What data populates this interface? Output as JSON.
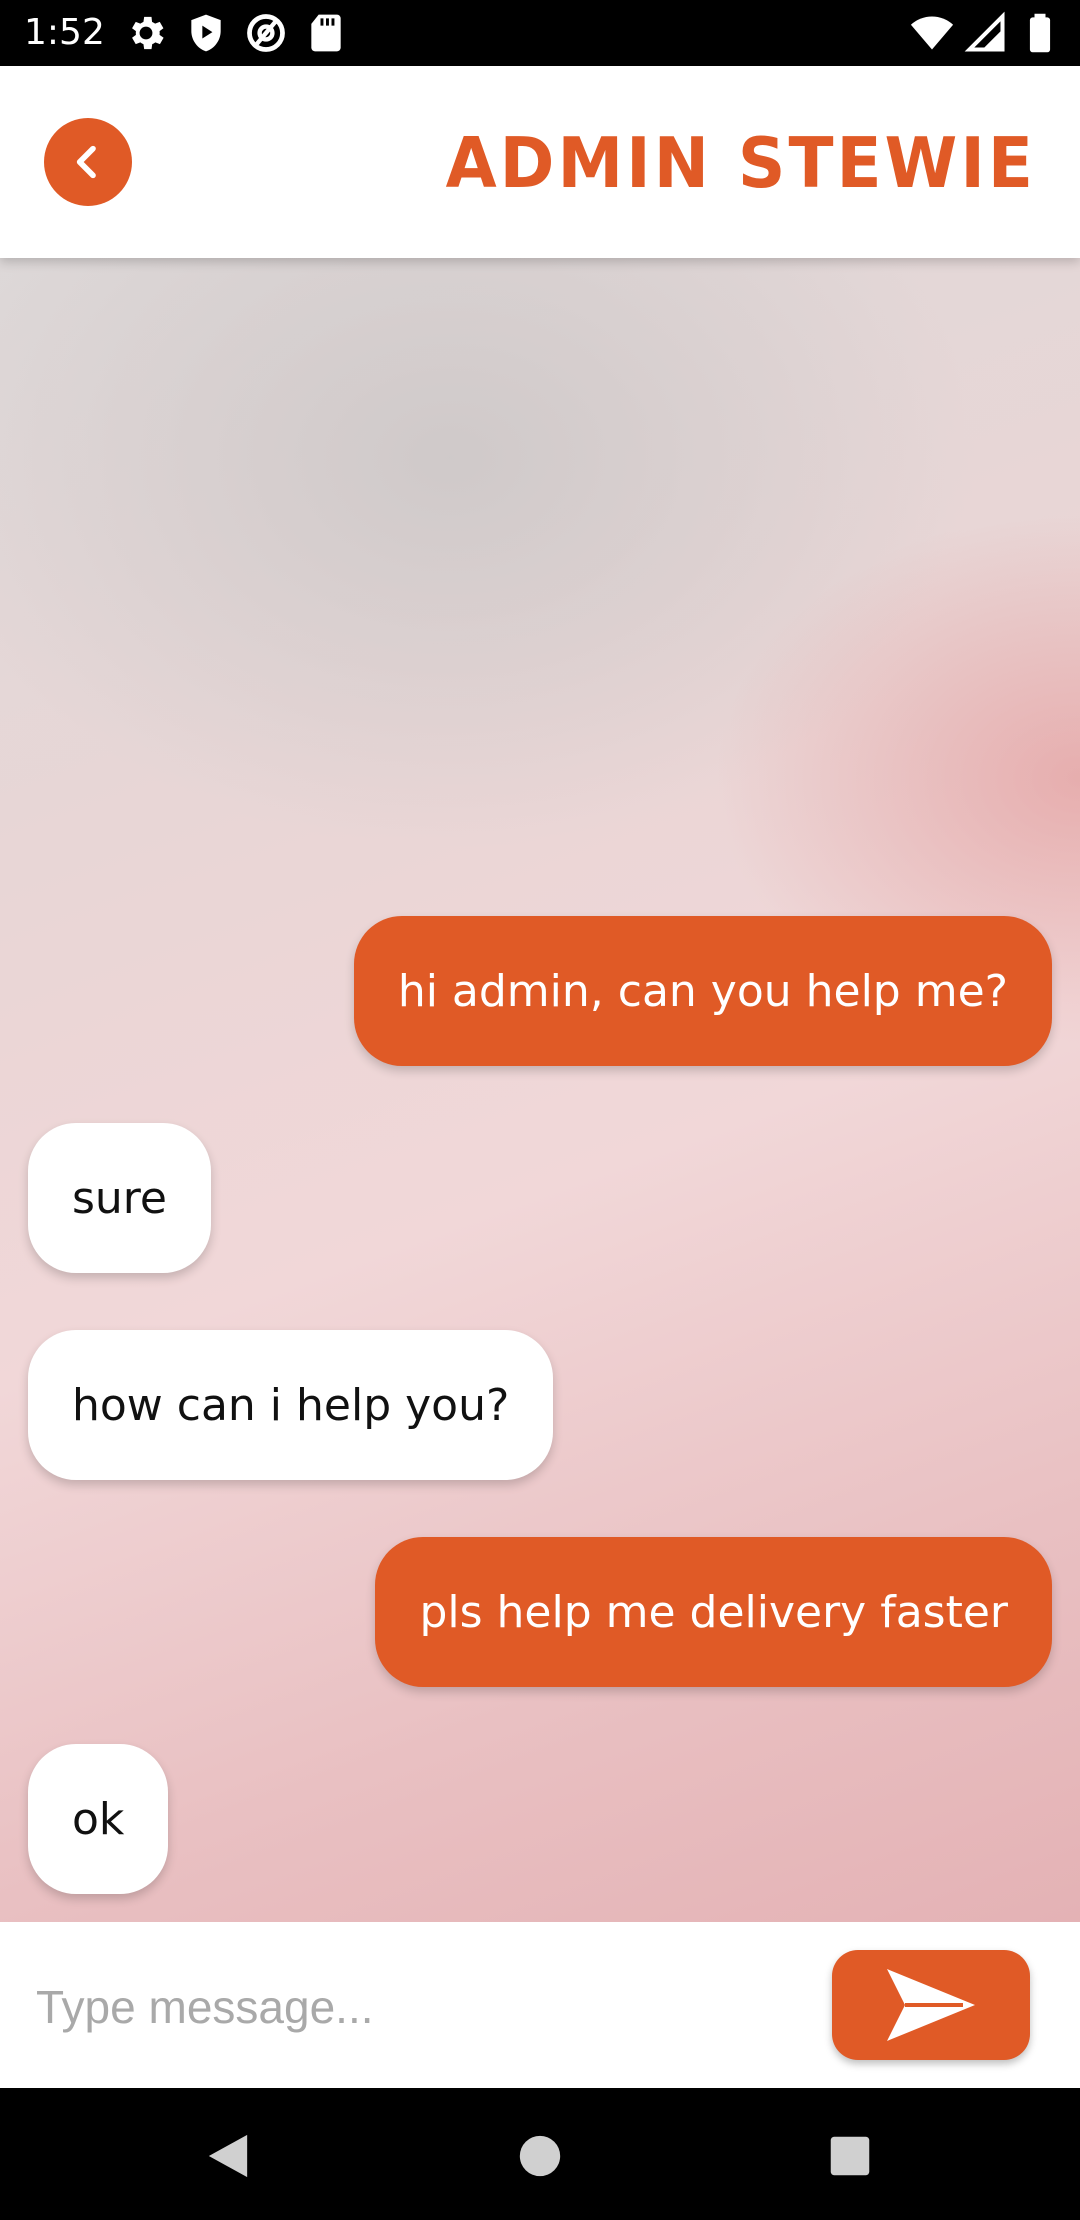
{
  "status_bar": {
    "time": "1:52",
    "left_icons": [
      "gear-icon",
      "shield-play-icon",
      "at-sign-icon",
      "sd-card-icon"
    ],
    "right_icons": [
      "wifi-icon",
      "cell-signal-icon",
      "battery-icon"
    ]
  },
  "header": {
    "title": "ADMIN STEWIE",
    "back_icon": "chevron-left-icon"
  },
  "messages": [
    {
      "text": "hi admin, can you help me?",
      "direction": "sent"
    },
    {
      "text": "sure",
      "direction": "received"
    },
    {
      "text": "how can i help you?",
      "direction": "received"
    },
    {
      "text": "pls help me delivery faster",
      "direction": "sent"
    },
    {
      "text": "ok",
      "direction": "received"
    }
  ],
  "composer": {
    "placeholder": "Type message...",
    "value": "",
    "send_icon": "send-arrow-icon"
  },
  "nav_bar": {
    "icons": [
      "back-triangle-icon",
      "home-circle-icon",
      "recents-square-icon"
    ]
  },
  "colors": {
    "accent": "#e05a26",
    "received_bubble": "#ffffff",
    "header_bg": "#ffffff"
  }
}
